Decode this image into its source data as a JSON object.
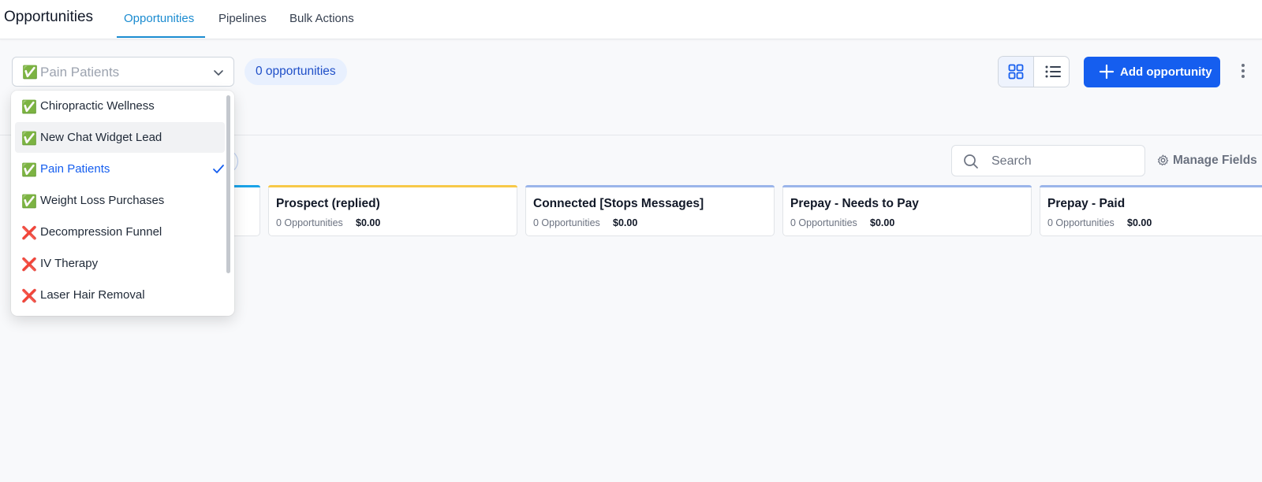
{
  "header": {
    "title": "Opportunities",
    "tabs": [
      {
        "label": "Opportunities",
        "active": true
      },
      {
        "label": "Pipelines",
        "active": false
      },
      {
        "label": "Bulk Actions",
        "active": false
      }
    ]
  },
  "toolbar": {
    "pipeline_select": {
      "emoji": "✅",
      "value": "Pain Patients"
    },
    "count_label": "0 opportunities",
    "add_button_label": "Add opportunity",
    "accent_color": "#155eef"
  },
  "filters": {
    "search_placeholder": "Search",
    "manage_fields_label": "Manage Fields"
  },
  "dropdown": {
    "options": [
      {
        "mark": "✅",
        "label": "Chiropractic Wellness",
        "state": "normal"
      },
      {
        "mark": "✅",
        "label": "New Chat Widget Lead",
        "state": "hover"
      },
      {
        "mark": "✅",
        "label": "Pain Patients",
        "state": "selected"
      },
      {
        "mark": "✅",
        "label": "Weight Loss Purchases",
        "state": "normal"
      },
      {
        "mark": "❌",
        "label": "Decompression Funnel",
        "state": "normal"
      },
      {
        "mark": "❌",
        "label": "IV Therapy",
        "state": "normal"
      },
      {
        "mark": "❌",
        "label": "Laser Hair Removal",
        "state": "normal"
      }
    ]
  },
  "stages": [
    {
      "name": "Prospect (replied)",
      "count": "0 Opportunities",
      "amount": "$0.00",
      "color": "#f7c948"
    },
    {
      "name": "Connected [Stops Messages]",
      "count": "0 Opportunities",
      "amount": "$0.00",
      "color": "#9bb5ea"
    },
    {
      "name": "Prepay - Needs to Pay",
      "count": "0 Opportunities",
      "amount": "$0.00",
      "color": "#9bb5ea"
    },
    {
      "name": "Prepay - Paid",
      "count": "0 Opportunities",
      "amount": "$0.00",
      "color": "#9bb5ea"
    }
  ]
}
